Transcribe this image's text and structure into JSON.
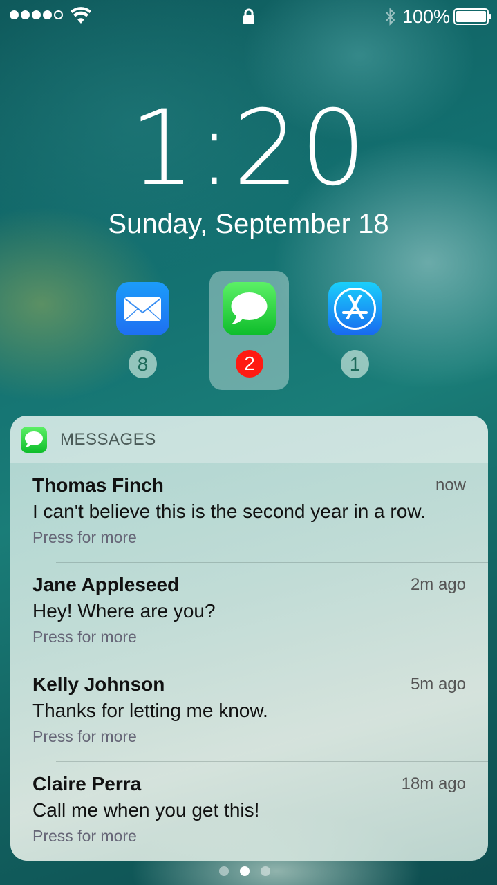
{
  "status_bar": {
    "signal_bars": 5,
    "signal_filled": 4,
    "battery_percent": "100%",
    "icons": [
      "wifi-icon",
      "lock-icon",
      "bluetooth-icon",
      "battery-icon"
    ]
  },
  "lock_screen": {
    "time": "1:20",
    "date": "Sunday, September 18"
  },
  "apps": [
    {
      "name": "Mail",
      "icon": "mail-icon",
      "badge": "8",
      "selected": false
    },
    {
      "name": "Messages",
      "icon": "messages-icon",
      "badge": "2",
      "selected": true
    },
    {
      "name": "App Store",
      "icon": "app-store-icon",
      "badge": "1",
      "selected": false
    }
  ],
  "notification": {
    "app_title": "MESSAGES",
    "app_icon": "messages-icon",
    "messages": [
      {
        "sender": "Thomas Finch",
        "time": "now",
        "text": "I can't believe this is the second year in a row.",
        "hint": "Press for more"
      },
      {
        "sender": "Jane Appleseed",
        "time": "2m ago",
        "text": "Hey! Where are you?",
        "hint": "Press for more"
      },
      {
        "sender": "Kelly Johnson",
        "time": "5m ago",
        "text": "Thanks for letting me know.",
        "hint": "Press for more"
      },
      {
        "sender": "Claire Perra",
        "time": "18m ago",
        "text": "Call me when you get this!",
        "hint": "Press for more"
      }
    ]
  },
  "page_indicator": {
    "pages": 3,
    "active": 2
  },
  "colors": {
    "badge_red": "#ff1a12",
    "messages_green": "#0ebd2b",
    "mail_blue": "#1e6ff1"
  }
}
